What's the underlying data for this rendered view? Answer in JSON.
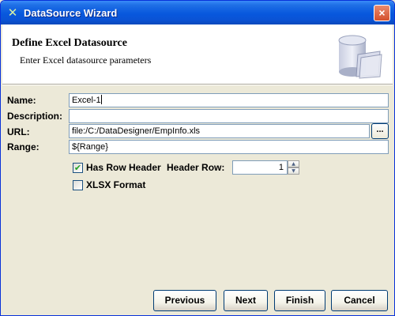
{
  "window": {
    "title": "DataSource Wizard",
    "close_glyph": "×"
  },
  "header": {
    "title": "Define Excel Datasource",
    "subtitle": "Enter Excel datasource parameters"
  },
  "form": {
    "name_label": "Name:",
    "name_value": "Excel-1",
    "description_label": "Description:",
    "description_value": "",
    "url_label": "URL:",
    "url_value": "file:/C:/DataDesigner/EmpInfo.xls",
    "browse_label": "...",
    "range_label": "Range:",
    "range_value": "${Range}",
    "has_row_header_label": "Has Row Header",
    "has_row_header_checked": true,
    "header_row_label": "Header Row:",
    "header_row_value": "1",
    "xlsx_format_label": "XLSX Format",
    "xlsx_format_checked": false
  },
  "buttons": {
    "previous": "Previous",
    "next": "Next",
    "finish": "Finish",
    "cancel": "Cancel"
  },
  "icons": {
    "title_icon": "wizard-icon",
    "header_graphic": "datasource-cylinder-icon"
  }
}
